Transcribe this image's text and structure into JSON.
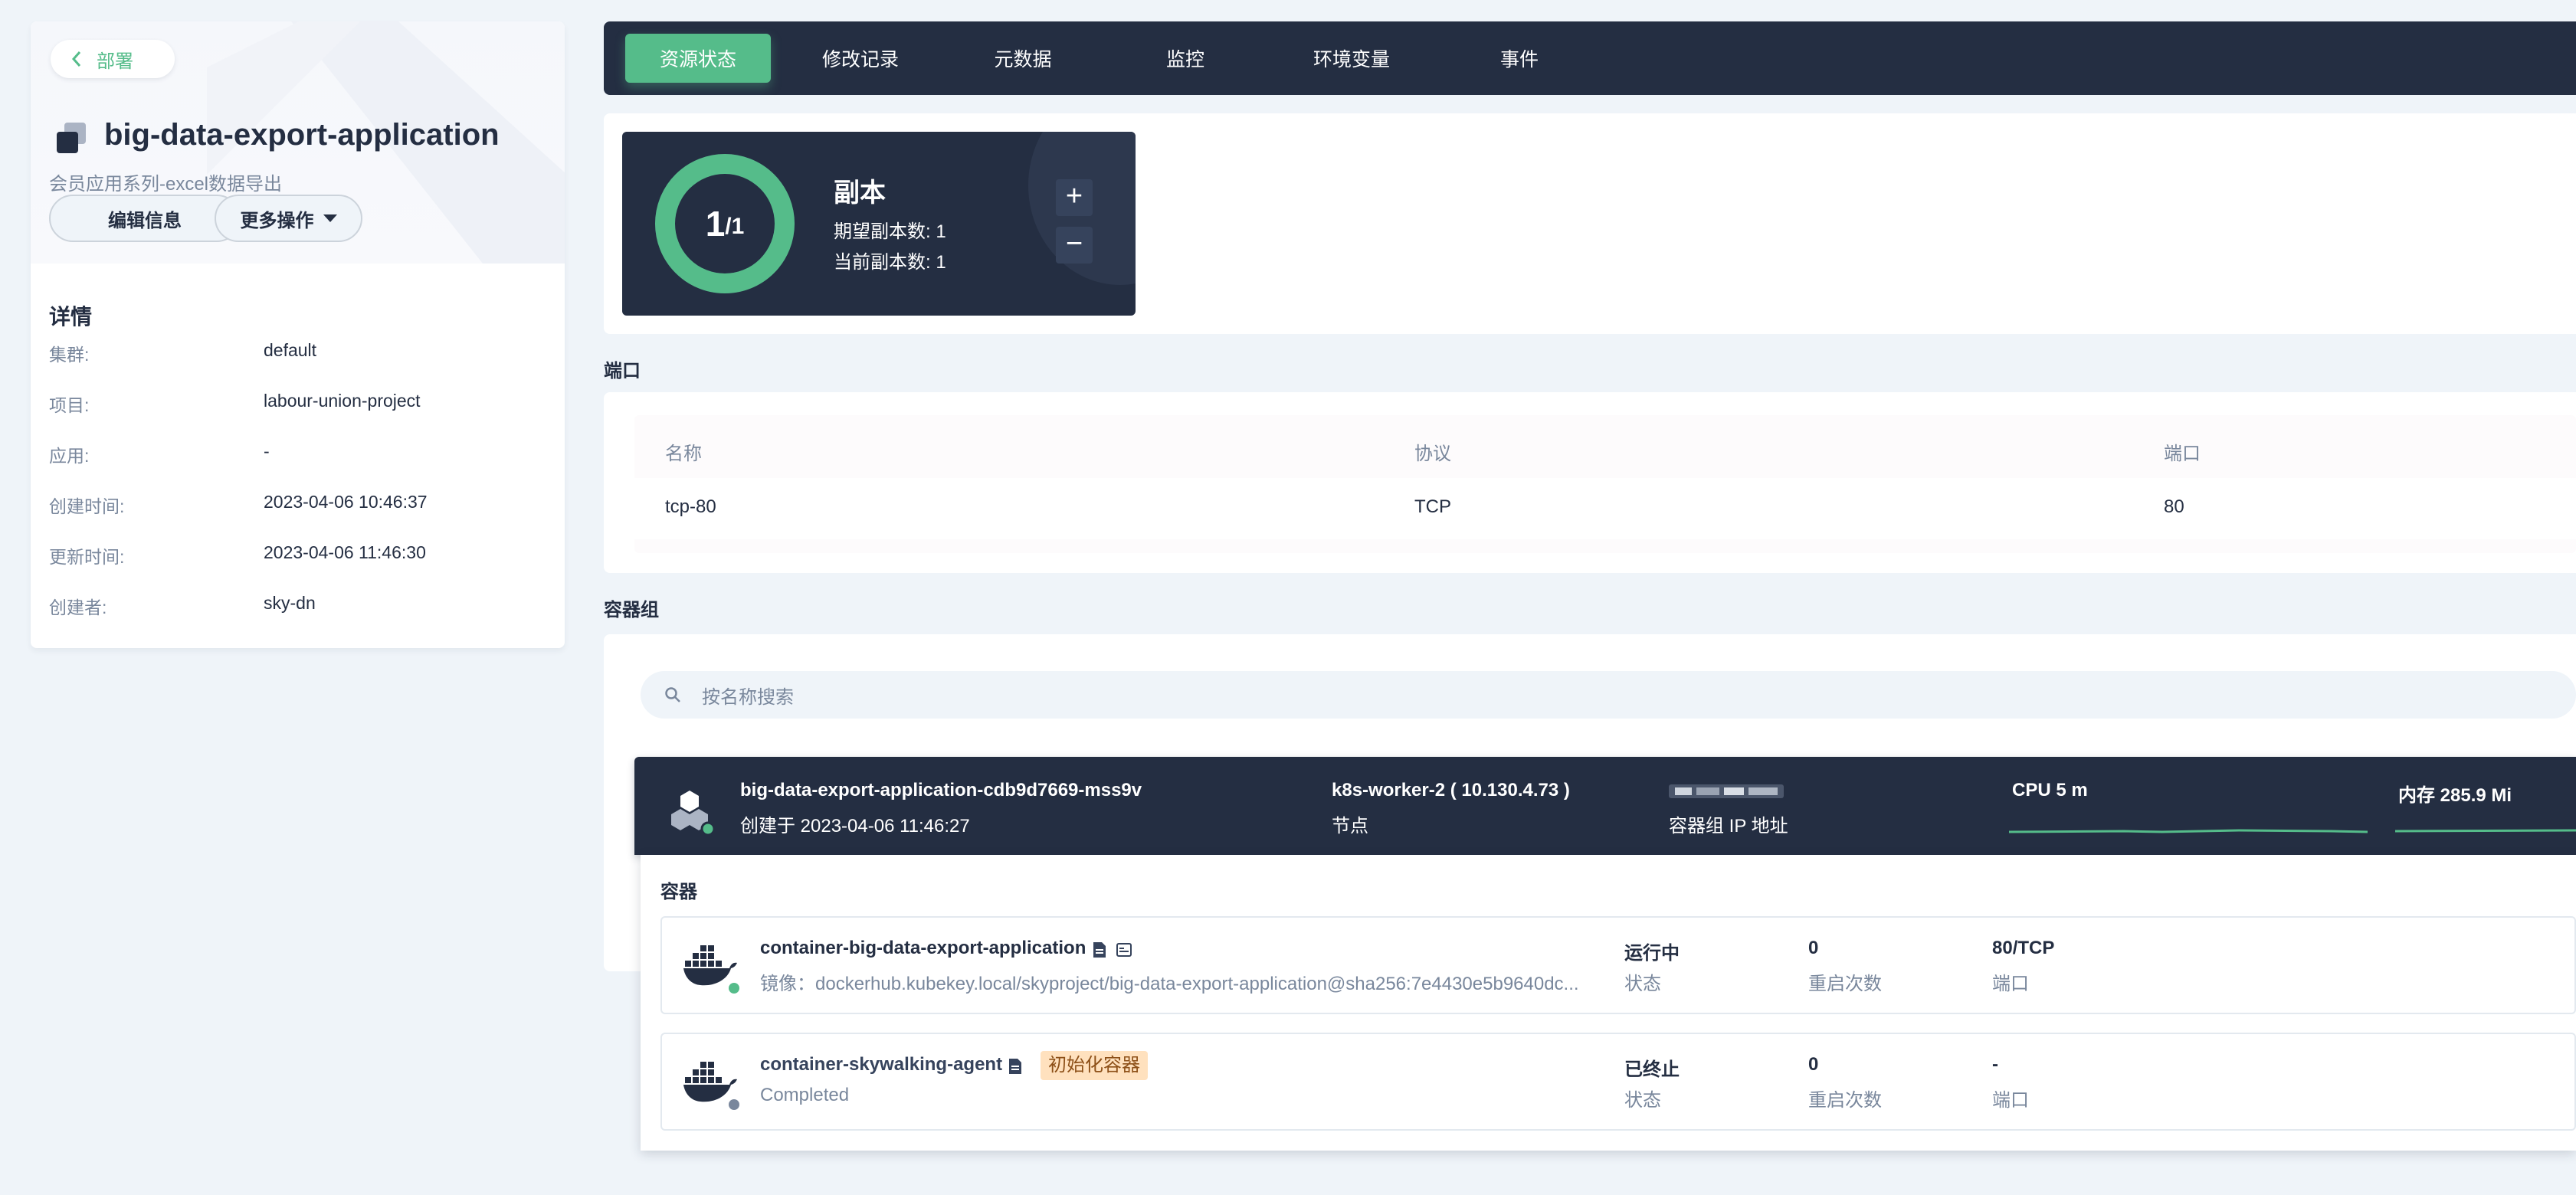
{
  "back_label": "部署",
  "app": {
    "title": "big-data-export-application",
    "description": "会员应用系列-excel数据导出",
    "edit_button": "编辑信息",
    "more_button": "更多操作"
  },
  "details": {
    "title": "详情",
    "rows": [
      {
        "key": "集群:",
        "value": "default"
      },
      {
        "key": "项目:",
        "value": "labour-union-project"
      },
      {
        "key": "应用:",
        "value": "-"
      },
      {
        "key": "创建时间:",
        "value": "2023-04-06 10:46:37"
      },
      {
        "key": "更新时间:",
        "value": "2023-04-06 11:46:30"
      },
      {
        "key": "创建者:",
        "value": "sky-dn"
      }
    ]
  },
  "tabs": [
    "资源状态",
    "修改记录",
    "元数据",
    "监控",
    "环境变量",
    "事件"
  ],
  "active_tab": "资源状态",
  "replicas": {
    "current": "1",
    "desired_label": "/1",
    "title": "副本",
    "desired_text": "期望副本数: 1",
    "current_text": "当前副本数: 1",
    "ratio": 1.0,
    "plus": "+",
    "minus": "−"
  },
  "ports": {
    "section_label": "端口",
    "headers": [
      "名称",
      "协议",
      "端口"
    ],
    "rows": [
      [
        "tcp-80",
        "TCP",
        "80"
      ]
    ]
  },
  "pods": {
    "section_label": "容器组",
    "search_placeholder": "按名称搜索",
    "pod": {
      "name": "big-data-export-application-cdb9d7669-mss9v",
      "created": "创建于 2023-04-06 11:46:27",
      "node": "k8s-worker-2 ( 10.130.4.73 )",
      "node_label": "节点",
      "ip_label": "容器组 IP 地址",
      "cpu": "CPU 5 m",
      "memory": "内存 285.9 Mi",
      "status_color": "#55bc8a"
    },
    "containers_label": "容器",
    "containers": [
      {
        "name": "container-big-data-export-application",
        "sub": "镜像：dockerhub.kubekey.local/skyproject/big-data-export-application@sha256:7e4430e5b9640dc...",
        "status": "运行中",
        "status_label": "状态",
        "restarts": "0",
        "restarts_label": "重启次数",
        "port": "80/TCP",
        "port_label": "端口",
        "dot_color": "#55bc8a"
      },
      {
        "name": "container-skywalking-agent",
        "badge": "初始化容器",
        "sub": "Completed",
        "status": "已终止",
        "status_label": "状态",
        "restarts": "0",
        "restarts_label": "重启次数",
        "port": "-",
        "port_label": "端口",
        "dot_color": "#79879c"
      }
    ]
  },
  "colors": {
    "accent": "#55bc8a",
    "dark": "#242e42",
    "muted": "#79879c",
    "badge_bg": "#ffe1be"
  }
}
